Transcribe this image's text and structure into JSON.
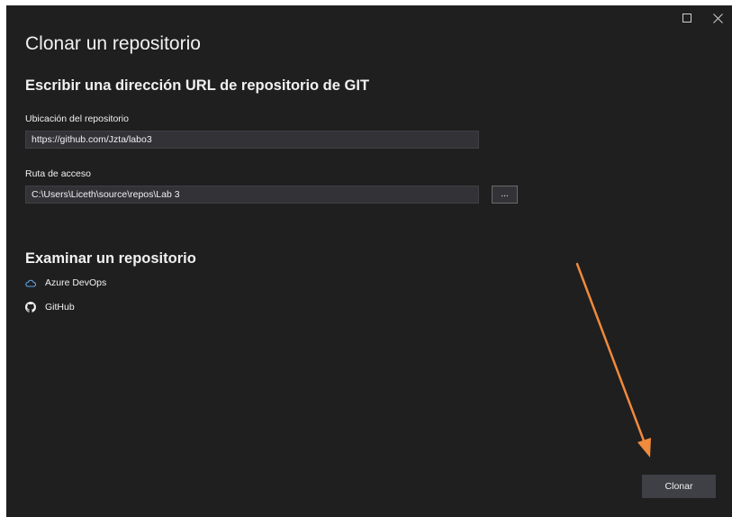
{
  "dialog": {
    "title": "Clonar un repositorio",
    "url_section_title": "Escribir una dirección URL de repositorio de GIT",
    "location_label": "Ubicación del repositorio",
    "location_value": "https://github.com/Jzta/labo3",
    "path_label": "Ruta de acceso",
    "path_value": "C:\\Users\\Liceth\\source\\repos\\Lab 3",
    "browse_label": "...",
    "browse_section_title": "Examinar un repositorio",
    "providers": [
      {
        "label": "Azure DevOps",
        "icon": "cloud-icon"
      },
      {
        "label": "GitHub",
        "icon": "github-icon"
      }
    ],
    "clone_label": "Clonar"
  },
  "window_controls": {
    "maximize_icon": "maximize-icon",
    "close_icon": "close-icon"
  },
  "colors": {
    "background": "#1f1f1f",
    "field_background": "#333337",
    "button_background": "#3f3f46",
    "text": "#f1f1f1",
    "azure_icon": "#5da3e8",
    "annotation_arrow": "#f08a3c"
  }
}
